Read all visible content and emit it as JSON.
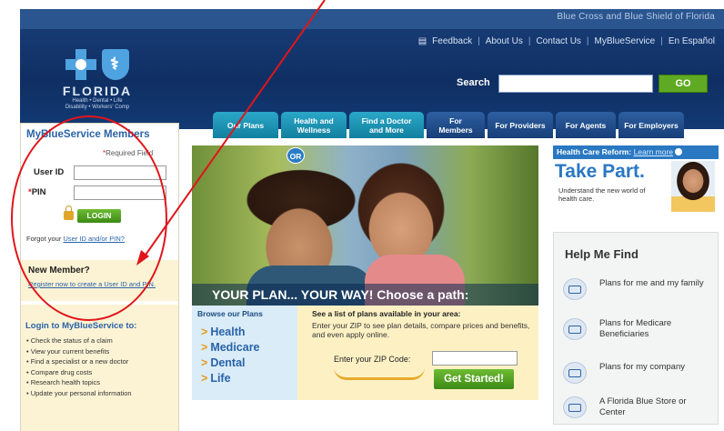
{
  "header": {
    "company": "Blue Cross and Blue Shield of Florida",
    "logo_name": "FLORIDA",
    "logo_sub1": "Health • Dental • Life",
    "logo_sub2": "Disability • Workers' Comp",
    "links": [
      "Feedback",
      "About Us",
      "Contact Us",
      "MyBlueService",
      "En Español"
    ],
    "search_label": "Search",
    "search_value": "",
    "go_label": "GO",
    "tabs": [
      {
        "label": "Our Plans",
        "style": "teal"
      },
      {
        "label": "Health and Wellness",
        "style": "teal"
      },
      {
        "label": "Find a Doctor and More",
        "style": "teal"
      },
      {
        "label": "For Members",
        "style": "blue"
      },
      {
        "label": "For Providers",
        "style": "blue"
      },
      {
        "label": "For Agents",
        "style": "blue"
      },
      {
        "label": "For Employers",
        "style": "blue"
      }
    ]
  },
  "login": {
    "title": "MyBlueService Members",
    "required": "Required Field",
    "userid_label": "User ID",
    "pin_label": "PIN",
    "login_button": "LOGIN",
    "forgot_prefix": "Forgot your ",
    "forgot_link": "User ID and/or PIN?",
    "new_member_title": "New Member?",
    "new_member_link": "Register now to create a User ID and PIN.",
    "login_to_title": "Login to MyBlueService to:",
    "login_to_items": [
      "• Check the status of a claim",
      "• View your current benefits",
      "• Find a specialist or a new doctor",
      "• Compare drug costs",
      "• Research health topics",
      "• Update your personal information"
    ]
  },
  "hero": {
    "tagline": "YOUR PLAN... YOUR WAY!  Choose a path:",
    "browse_title": "Browse our Plans",
    "or_label": "OR",
    "browse_items": [
      "Health",
      "Medicare",
      "Dental",
      "Life"
    ],
    "zip_title": "See a list of plans available in your area:",
    "zip_text": "Enter your ZIP to see plan details, compare prices and benefits, and even apply online.",
    "zip_label": "Enter your ZIP Code:",
    "zip_value": "",
    "get_started": "Get Started!"
  },
  "right": {
    "hcr_label": "Health Care Reform:",
    "hcr_link": "Learn more",
    "take_part": "Take Part.",
    "take_part_text": "Understand the new world of health care.",
    "help_title": "Help Me Find",
    "help_items": [
      "Plans for me and my family",
      "Plans for Medicare Beneficiaries",
      "Plans for my company",
      "A Florida Blue Store or Center"
    ]
  },
  "colors": {
    "header_blue": "#1a3f7a",
    "link_blue": "#2a63a8",
    "green_button": "#5faa22",
    "annotation_red": "#e0151b"
  }
}
